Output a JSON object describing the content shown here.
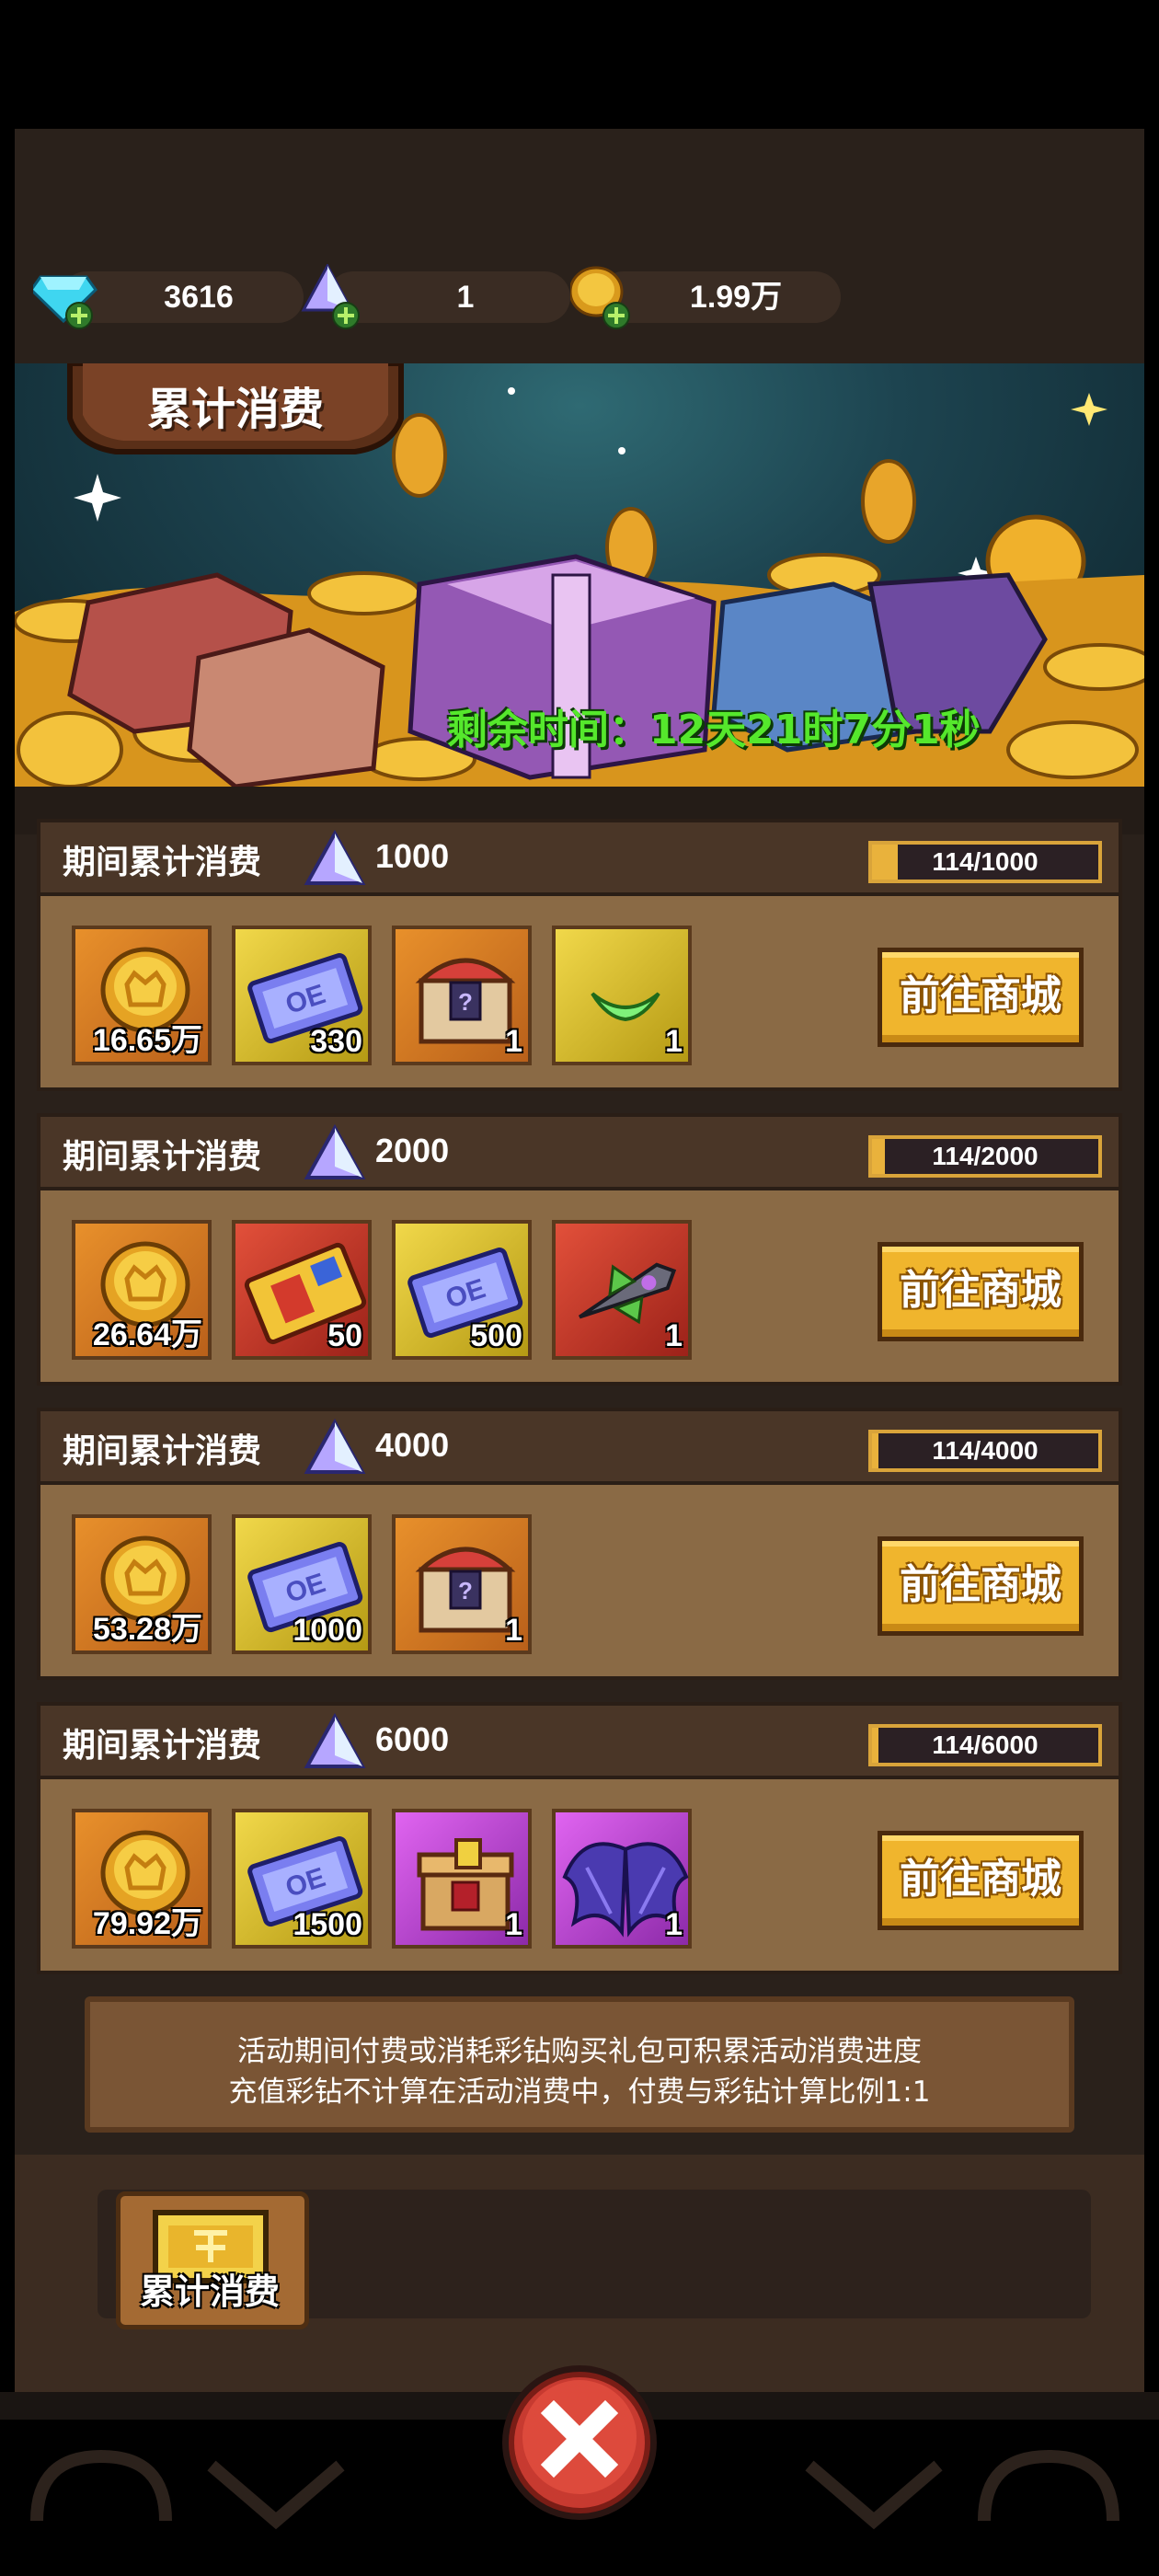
{
  "currency": {
    "diamond": "3616",
    "crystal": "1",
    "gold": "1.99万"
  },
  "banner": {
    "title": "累计消费",
    "timer": "剩余时间：12天21时7分1秒"
  },
  "tiers": [
    {
      "label": "期间累计消费",
      "amount": "1000",
      "progress_text": "114/1000",
      "progress_fraction": 0.114,
      "rewards": [
        {
          "icon": "gold-coin-icon",
          "qty": "16.65万"
        },
        {
          "icon": "ticket-icon",
          "qty": "330"
        },
        {
          "icon": "treasure-chest-icon",
          "qty": "1"
        },
        {
          "icon": "green-gem-icon",
          "qty": "1"
        }
      ],
      "button": "前往商城"
    },
    {
      "label": "期间累计消费",
      "amount": "2000",
      "progress_text": "114/2000",
      "progress_fraction": 0.057,
      "rewards": [
        {
          "icon": "gold-coin-icon",
          "qty": "26.64万"
        },
        {
          "icon": "coupon-card-icon",
          "qty": "50"
        },
        {
          "icon": "ticket-icon",
          "qty": "500"
        },
        {
          "icon": "spaceship-icon",
          "qty": "1"
        }
      ],
      "button": "前往商城"
    },
    {
      "label": "期间累计消费",
      "amount": "4000",
      "progress_text": "114/4000",
      "progress_fraction": 0.0285,
      "rewards": [
        {
          "icon": "gold-coin-icon",
          "qty": "53.28万"
        },
        {
          "icon": "ticket-icon",
          "qty": "1000"
        },
        {
          "icon": "treasure-chest-icon",
          "qty": "1"
        }
      ],
      "button": "前往商城"
    },
    {
      "label": "期间累计消费",
      "amount": "6000",
      "progress_text": "114/6000",
      "progress_fraction": 0.019,
      "rewards": [
        {
          "icon": "gold-coin-icon",
          "qty": "79.92万"
        },
        {
          "icon": "ticket-icon",
          "qty": "1500"
        },
        {
          "icon": "gift-box-icon",
          "qty": "1"
        },
        {
          "icon": "wings-icon",
          "qty": "1"
        }
      ],
      "button": "前往商城"
    }
  ],
  "notice": {
    "line1": "活动期间付费或消耗彩钻购买礼包可积累活动消费进度",
    "line2": "充值彩钻不计算在活动消费中，付费与彩钻计算比例1:1"
  },
  "tab": {
    "label": "累计消费"
  },
  "colors": {
    "accent_gold": "#f0b52d",
    "timer_green": "#55e82c",
    "panel_brown": "#8a6a45"
  }
}
